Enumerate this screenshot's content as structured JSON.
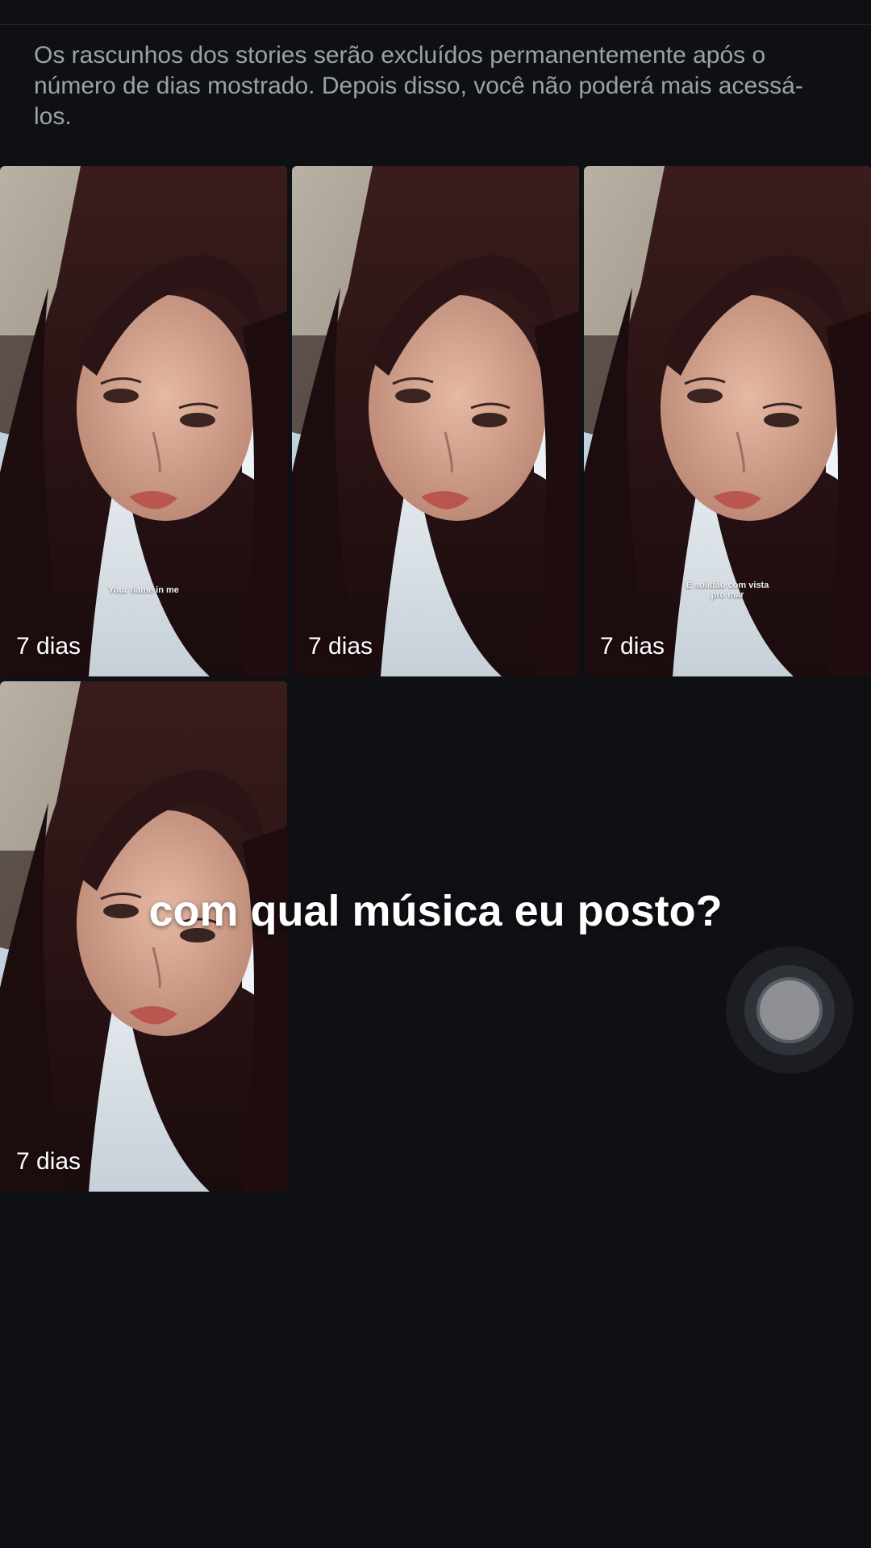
{
  "notice": {
    "text": "Os rascunhos dos stories serão excluídos permanentemente após o número de dias mostrado. Depois disso, você não poderá mais acessá-los."
  },
  "drafts": [
    {
      "days_label": "7 dias",
      "sticker": "Your flame in me",
      "sticker_small": ""
    },
    {
      "days_label": "7 dias",
      "sticker": "",
      "sticker_small": ""
    },
    {
      "days_label": "7 dias",
      "sticker": "É solidão com vista pro mar",
      "sticker_small": ""
    },
    {
      "days_label": "7 dias",
      "sticker": "",
      "sticker_small": ""
    }
  ],
  "overlay": {
    "caption": "com qual música eu posto?"
  },
  "colors": {
    "background": "#0e1014",
    "notice_text": "#9ca1a9",
    "label_text": "#ffffff"
  }
}
